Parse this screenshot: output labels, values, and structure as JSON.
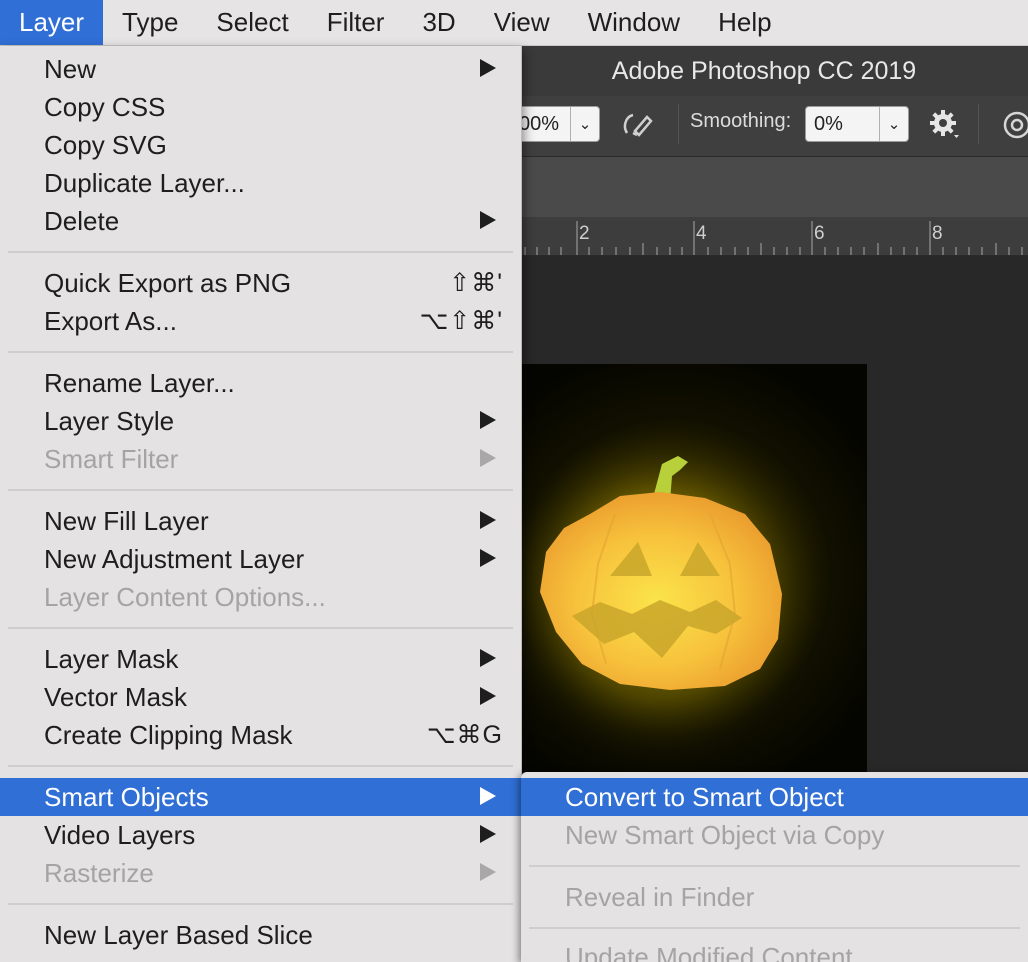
{
  "menubar": {
    "items": [
      {
        "label": "Layer",
        "active": true
      },
      {
        "label": "Type"
      },
      {
        "label": "Select"
      },
      {
        "label": "Filter"
      },
      {
        "label": "3D"
      },
      {
        "label": "View"
      },
      {
        "label": "Window"
      },
      {
        "label": "Help"
      }
    ]
  },
  "app": {
    "title": "Adobe Photoshop CC 2019",
    "options": {
      "flow_value": "00%",
      "smoothing_label": "Smoothing:",
      "smoothing_value": "0%"
    },
    "ruler": [
      "2",
      "4",
      "6",
      "8"
    ]
  },
  "layer_menu": {
    "new": "New",
    "copy_css": "Copy CSS",
    "copy_svg": "Copy SVG",
    "duplicate": "Duplicate Layer...",
    "delete": "Delete",
    "quick_export": "Quick Export as PNG",
    "quick_export_sc": "⇧⌘'",
    "export_as": "Export As...",
    "export_as_sc": "⌥⇧⌘'",
    "rename": "Rename Layer...",
    "layer_style": "Layer Style",
    "smart_filter": "Smart Filter",
    "new_fill": "New Fill Layer",
    "new_adjustment": "New Adjustment Layer",
    "content_options": "Layer Content Options...",
    "layer_mask": "Layer Mask",
    "vector_mask": "Vector Mask",
    "clipping_mask": "Create Clipping Mask",
    "clipping_mask_sc": "⌥⌘G",
    "smart_objects": "Smart Objects",
    "video_layers": "Video Layers",
    "rasterize": "Rasterize",
    "layer_slice": "New Layer Based Slice"
  },
  "smart_objects_menu": {
    "convert": "Convert to Smart Object",
    "new_via_copy": "New Smart Object via Copy",
    "reveal": "Reveal in Finder",
    "update_modified": "Update Modified Content"
  },
  "colors": {
    "highlight": "#2f6fd6",
    "menu_bg": "#e4e2e2",
    "disabled_text": "#a5a3a3"
  }
}
